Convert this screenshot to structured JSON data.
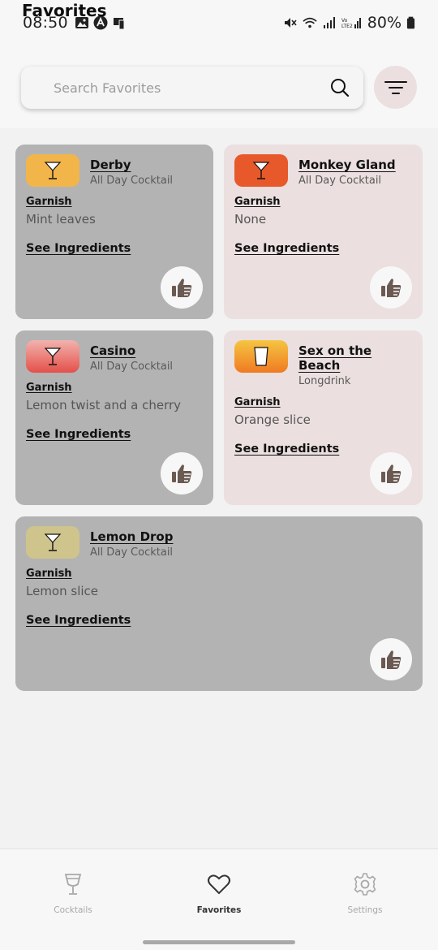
{
  "status": {
    "time": "08:50",
    "battery": "80%"
  },
  "header": {
    "title": "Favorites",
    "search_placeholder": "Search Favorites"
  },
  "cards": [
    {
      "name": "Derby",
      "category": "All Day Cocktail",
      "garnish_label": "Garnish",
      "garnish": "Mint leaves",
      "link": "See Ingredients",
      "bg": "gray",
      "thumb_color": "#f2b54a",
      "thumb_icon": "cocktail-glass-icon"
    },
    {
      "name": "Monkey Gland",
      "category": "All Day Cocktail",
      "garnish_label": "Garnish",
      "garnish": "None",
      "link": "See Ingredients",
      "bg": "pink",
      "thumb_color": "#e7592a",
      "thumb_icon": "cocktail-glass-icon"
    },
    {
      "name": "Casino",
      "category": "All Day Cocktail",
      "garnish_label": "Garnish",
      "garnish": "Lemon twist and a cherry",
      "link": "See Ingredients",
      "bg": "gray",
      "thumb_color": "#e4504a",
      "thumb_icon": "cocktail-glass-icon"
    },
    {
      "name": "Sex on the Beach",
      "category": "Longdrink",
      "garnish_label": "Garnish",
      "garnish": "Orange slice",
      "link": "See Ingredients",
      "bg": "pink",
      "thumb_color": "#f3902e",
      "thumb_icon": "highball-glass-icon"
    },
    {
      "name": "Lemon Drop",
      "category": "All Day Cocktail",
      "garnish_label": "Garnish",
      "garnish": "Lemon slice",
      "link": "See Ingredients",
      "bg": "gray",
      "thumb_color": "#cfc48c",
      "thumb_icon": "cocktail-glass-icon"
    }
  ],
  "nav": {
    "items": [
      {
        "label": "Cocktails",
        "icon": "glass-icon",
        "active": false
      },
      {
        "label": "Favorites",
        "icon": "heart-icon",
        "active": true
      },
      {
        "label": "Settings",
        "icon": "gear-icon",
        "active": false
      }
    ]
  },
  "colors": {
    "card_gray": "#b3b3b3",
    "card_pink": "#ebdfdf",
    "thumb_icon_fill": "#6b5a52"
  }
}
